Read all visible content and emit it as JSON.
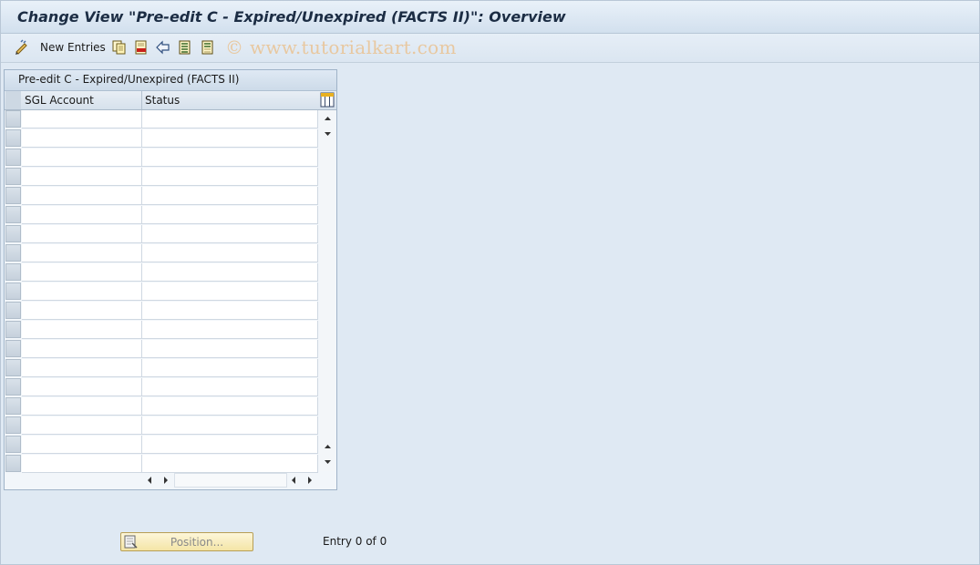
{
  "window": {
    "title": "Change View \"Pre-edit C - Expired/Unexpired  (FACTS II)\": Overview"
  },
  "toolbar": {
    "new_entries_label": "New Entries",
    "watermark": "© www.tutorialkart.com",
    "icons": [
      "edit-toggle-icon",
      "copy-icon",
      "delete-icon",
      "undo-change-icon",
      "select-all-icon",
      "select-block-icon"
    ]
  },
  "table": {
    "title": "Pre-edit C - Expired/Unexpired  (FACTS II)",
    "columns": [
      "SGL Account",
      "Status"
    ],
    "rows": [
      {
        "sgl_account": "",
        "status": ""
      },
      {
        "sgl_account": "",
        "status": ""
      },
      {
        "sgl_account": "",
        "status": ""
      },
      {
        "sgl_account": "",
        "status": ""
      },
      {
        "sgl_account": "",
        "status": ""
      },
      {
        "sgl_account": "",
        "status": ""
      },
      {
        "sgl_account": "",
        "status": ""
      },
      {
        "sgl_account": "",
        "status": ""
      },
      {
        "sgl_account": "",
        "status": ""
      },
      {
        "sgl_account": "",
        "status": ""
      },
      {
        "sgl_account": "",
        "status": ""
      },
      {
        "sgl_account": "",
        "status": ""
      },
      {
        "sgl_account": "",
        "status": ""
      },
      {
        "sgl_account": "",
        "status": ""
      },
      {
        "sgl_account": "",
        "status": ""
      },
      {
        "sgl_account": "",
        "status": ""
      },
      {
        "sgl_account": "",
        "status": ""
      },
      {
        "sgl_account": "",
        "status": ""
      },
      {
        "sgl_account": "",
        "status": ""
      }
    ]
  },
  "footer": {
    "position_button_label": "Position...",
    "entry_count_text": "Entry 0 of 0"
  },
  "colors": {
    "background": "#dfe9f3",
    "title_text": "#1c2d44",
    "button_bg": "#f4e5a6"
  }
}
